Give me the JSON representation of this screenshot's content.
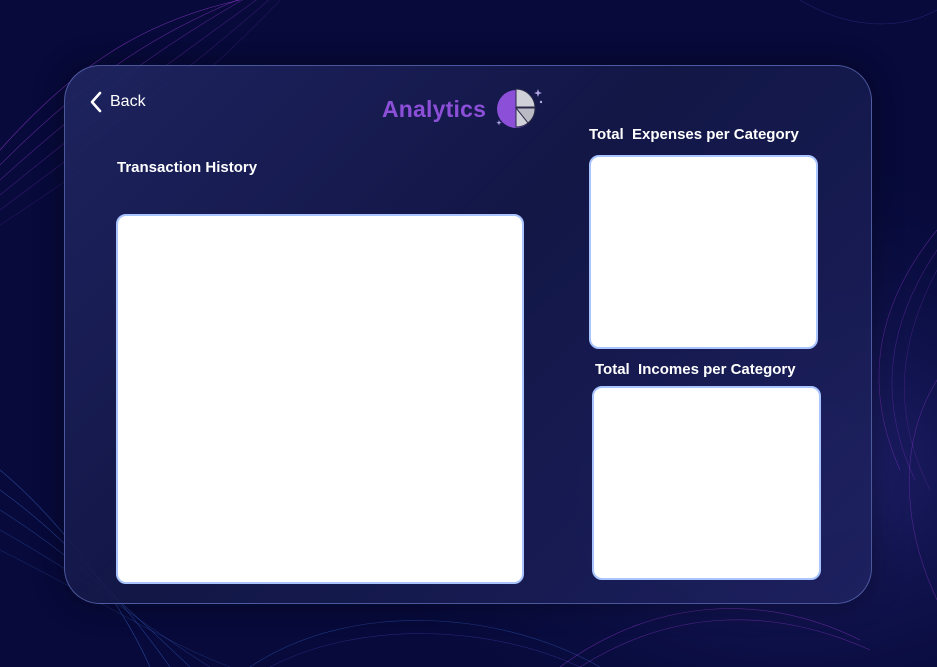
{
  "header": {
    "back_label": "Back",
    "title": "Analytics",
    "title_color": "#8b4fd8",
    "title_icon": "pie-chart-icon"
  },
  "sections": {
    "transaction_history": {
      "label": "Transaction History"
    },
    "expenses_per_category": {
      "label": "Total  Expenses per Category"
    },
    "incomes_per_category": {
      "label": "Total  Incomes per Category"
    }
  },
  "theme": {
    "background": "#070a3a",
    "panel": "#1a1f5a",
    "card_border": "#a9c4ff",
    "accent": "#8b4fd8"
  }
}
